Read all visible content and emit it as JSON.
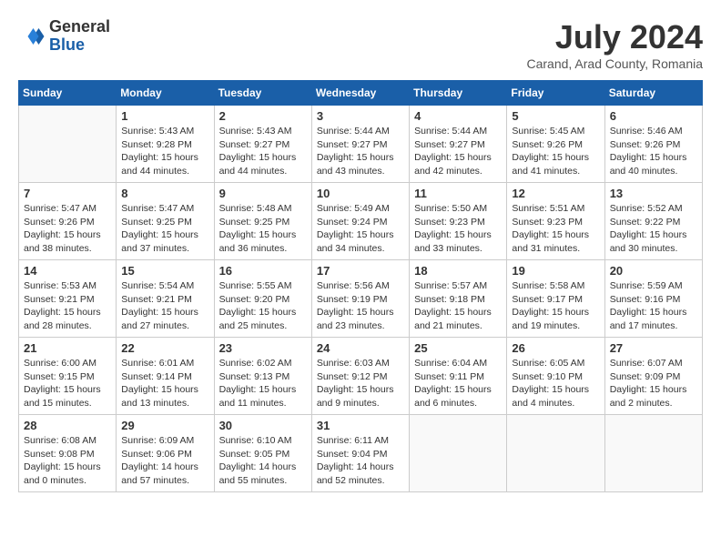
{
  "header": {
    "logo_general": "General",
    "logo_blue": "Blue",
    "month_title": "July 2024",
    "location": "Carand, Arad County, Romania"
  },
  "weekdays": [
    "Sunday",
    "Monday",
    "Tuesday",
    "Wednesday",
    "Thursday",
    "Friday",
    "Saturday"
  ],
  "weeks": [
    [
      {
        "day": "",
        "info": ""
      },
      {
        "day": "1",
        "info": "Sunrise: 5:43 AM\nSunset: 9:28 PM\nDaylight: 15 hours\nand 44 minutes."
      },
      {
        "day": "2",
        "info": "Sunrise: 5:43 AM\nSunset: 9:27 PM\nDaylight: 15 hours\nand 44 minutes."
      },
      {
        "day": "3",
        "info": "Sunrise: 5:44 AM\nSunset: 9:27 PM\nDaylight: 15 hours\nand 43 minutes."
      },
      {
        "day": "4",
        "info": "Sunrise: 5:44 AM\nSunset: 9:27 PM\nDaylight: 15 hours\nand 42 minutes."
      },
      {
        "day": "5",
        "info": "Sunrise: 5:45 AM\nSunset: 9:26 PM\nDaylight: 15 hours\nand 41 minutes."
      },
      {
        "day": "6",
        "info": "Sunrise: 5:46 AM\nSunset: 9:26 PM\nDaylight: 15 hours\nand 40 minutes."
      }
    ],
    [
      {
        "day": "7",
        "info": "Sunrise: 5:47 AM\nSunset: 9:26 PM\nDaylight: 15 hours\nand 38 minutes."
      },
      {
        "day": "8",
        "info": "Sunrise: 5:47 AM\nSunset: 9:25 PM\nDaylight: 15 hours\nand 37 minutes."
      },
      {
        "day": "9",
        "info": "Sunrise: 5:48 AM\nSunset: 9:25 PM\nDaylight: 15 hours\nand 36 minutes."
      },
      {
        "day": "10",
        "info": "Sunrise: 5:49 AM\nSunset: 9:24 PM\nDaylight: 15 hours\nand 34 minutes."
      },
      {
        "day": "11",
        "info": "Sunrise: 5:50 AM\nSunset: 9:23 PM\nDaylight: 15 hours\nand 33 minutes."
      },
      {
        "day": "12",
        "info": "Sunrise: 5:51 AM\nSunset: 9:23 PM\nDaylight: 15 hours\nand 31 minutes."
      },
      {
        "day": "13",
        "info": "Sunrise: 5:52 AM\nSunset: 9:22 PM\nDaylight: 15 hours\nand 30 minutes."
      }
    ],
    [
      {
        "day": "14",
        "info": "Sunrise: 5:53 AM\nSunset: 9:21 PM\nDaylight: 15 hours\nand 28 minutes."
      },
      {
        "day": "15",
        "info": "Sunrise: 5:54 AM\nSunset: 9:21 PM\nDaylight: 15 hours\nand 27 minutes."
      },
      {
        "day": "16",
        "info": "Sunrise: 5:55 AM\nSunset: 9:20 PM\nDaylight: 15 hours\nand 25 minutes."
      },
      {
        "day": "17",
        "info": "Sunrise: 5:56 AM\nSunset: 9:19 PM\nDaylight: 15 hours\nand 23 minutes."
      },
      {
        "day": "18",
        "info": "Sunrise: 5:57 AM\nSunset: 9:18 PM\nDaylight: 15 hours\nand 21 minutes."
      },
      {
        "day": "19",
        "info": "Sunrise: 5:58 AM\nSunset: 9:17 PM\nDaylight: 15 hours\nand 19 minutes."
      },
      {
        "day": "20",
        "info": "Sunrise: 5:59 AM\nSunset: 9:16 PM\nDaylight: 15 hours\nand 17 minutes."
      }
    ],
    [
      {
        "day": "21",
        "info": "Sunrise: 6:00 AM\nSunset: 9:15 PM\nDaylight: 15 hours\nand 15 minutes."
      },
      {
        "day": "22",
        "info": "Sunrise: 6:01 AM\nSunset: 9:14 PM\nDaylight: 15 hours\nand 13 minutes."
      },
      {
        "day": "23",
        "info": "Sunrise: 6:02 AM\nSunset: 9:13 PM\nDaylight: 15 hours\nand 11 minutes."
      },
      {
        "day": "24",
        "info": "Sunrise: 6:03 AM\nSunset: 9:12 PM\nDaylight: 15 hours\nand 9 minutes."
      },
      {
        "day": "25",
        "info": "Sunrise: 6:04 AM\nSunset: 9:11 PM\nDaylight: 15 hours\nand 6 minutes."
      },
      {
        "day": "26",
        "info": "Sunrise: 6:05 AM\nSunset: 9:10 PM\nDaylight: 15 hours\nand 4 minutes."
      },
      {
        "day": "27",
        "info": "Sunrise: 6:07 AM\nSunset: 9:09 PM\nDaylight: 15 hours\nand 2 minutes."
      }
    ],
    [
      {
        "day": "28",
        "info": "Sunrise: 6:08 AM\nSunset: 9:08 PM\nDaylight: 15 hours\nand 0 minutes."
      },
      {
        "day": "29",
        "info": "Sunrise: 6:09 AM\nSunset: 9:06 PM\nDaylight: 14 hours\nand 57 minutes."
      },
      {
        "day": "30",
        "info": "Sunrise: 6:10 AM\nSunset: 9:05 PM\nDaylight: 14 hours\nand 55 minutes."
      },
      {
        "day": "31",
        "info": "Sunrise: 6:11 AM\nSunset: 9:04 PM\nDaylight: 14 hours\nand 52 minutes."
      },
      {
        "day": "",
        "info": ""
      },
      {
        "day": "",
        "info": ""
      },
      {
        "day": "",
        "info": ""
      }
    ]
  ]
}
